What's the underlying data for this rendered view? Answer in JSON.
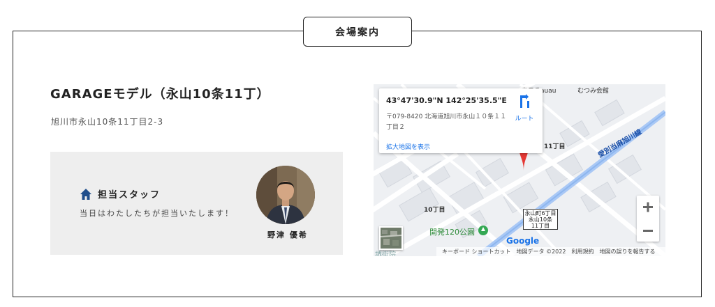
{
  "section": {
    "tab_label": "会場案内"
  },
  "venue": {
    "title": "GARAGEモデル（永山10条11丁）",
    "address": "旭川市永山10条11丁目2-3"
  },
  "staff": {
    "heading": "担当スタッフ",
    "message": "当日はわたしたちが担当いたします！",
    "name": "野津 優希",
    "icon": "house-icon"
  },
  "map": {
    "coords": "43°47'30.9\"N 142°25'35.5\"E",
    "address": "〒079-8420 北海道旭川市永山１０条１１丁目２",
    "route_label": "ルート",
    "enlarge_link": "拡大地図を表示",
    "labels": {
      "top_store": "あ〒るauau",
      "top_right": "むつみ会館",
      "chome11": "11丁目",
      "chome10": "10丁目",
      "road": "愛別当麻旭川線",
      "park": "開発120公園",
      "block": "永山町6丁目\n永山10条\n11丁目",
      "bottom_left": "堺街院"
    },
    "zoom_in": "+",
    "zoom_out": "−",
    "google": "Google",
    "footer": {
      "shortcuts": "キーボード ショートカット",
      "map_data": "地図データ ©2022",
      "terms": "利用規約",
      "report": "地図の誤りを報告する"
    },
    "colors": {
      "pin": "#e53935",
      "road": "#a9c8f5",
      "park": "#34a853",
      "link": "#1a73e8"
    }
  }
}
